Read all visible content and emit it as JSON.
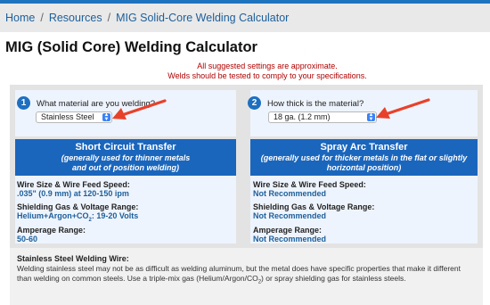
{
  "breadcrumb": {
    "home": "Home",
    "sep1": "/",
    "resources": "Resources",
    "sep2": "/",
    "current": "MIG Solid-Core Welding Calculator"
  },
  "page_title": "MIG (Solid Core) Welding Calculator",
  "disclaimer": {
    "line1": "All suggested settings are approximate.",
    "line2": "Welds should be tested to comply to your specifications."
  },
  "step1": {
    "number": "1",
    "question": "What material are you welding?",
    "selected": "Stainless Steel"
  },
  "step2": {
    "number": "2",
    "question": "How thick is the material?",
    "selected": "18 ga. (1.2 mm)"
  },
  "short_circuit": {
    "title": "Short Circuit Transfer",
    "subtitle_line1": "(generally used for thinner metals",
    "subtitle_line2": "and out of position welding)",
    "wire_label": "Wire Size & Wire Feed Speed:",
    "wire_value": ".035\" (0.9 mm) at 120-150 ipm",
    "gas_label": "Shielding Gas & Voltage Range:",
    "gas_value_prefix": "Helium+Argon+CO",
    "gas_value_sub": "2",
    "gas_value_suffix": ": 19-20 Volts",
    "amp_label": "Amperage Range:",
    "amp_value": "50-60"
  },
  "spray_arc": {
    "title": "Spray Arc Transfer",
    "subtitle_line1": "(generally used for thicker metals in the flat or slightly",
    "subtitle_line2": "horizontal position)",
    "wire_label": "Wire Size & Wire Feed Speed:",
    "wire_value": "Not Recommended",
    "gas_label": "Shielding Gas & Voltage Range:",
    "gas_value": "Not Recommended",
    "amp_label": "Amperage Range:",
    "amp_value": "Not Recommended"
  },
  "info": {
    "title": "Stainless Steel Welding Wire:",
    "body_part1": "Welding stainless steel may not be as difficult as welding aluminum, but the metal does have specific properties that make it different than welding on common steels. Use a triple-mix gas (Helium/Argon/CO",
    "body_sub": "2",
    "body_part2": ") or spray shielding gas for stainless steels."
  },
  "colors": {
    "accent_blue": "#1b66bd",
    "link_blue": "#1d5f9a",
    "warning_red": "#b00000",
    "arrow_red": "#e8412a"
  },
  "icons": {
    "select_chevron": "chevron-updown-icon",
    "pointer": "red-arrow-icon"
  }
}
